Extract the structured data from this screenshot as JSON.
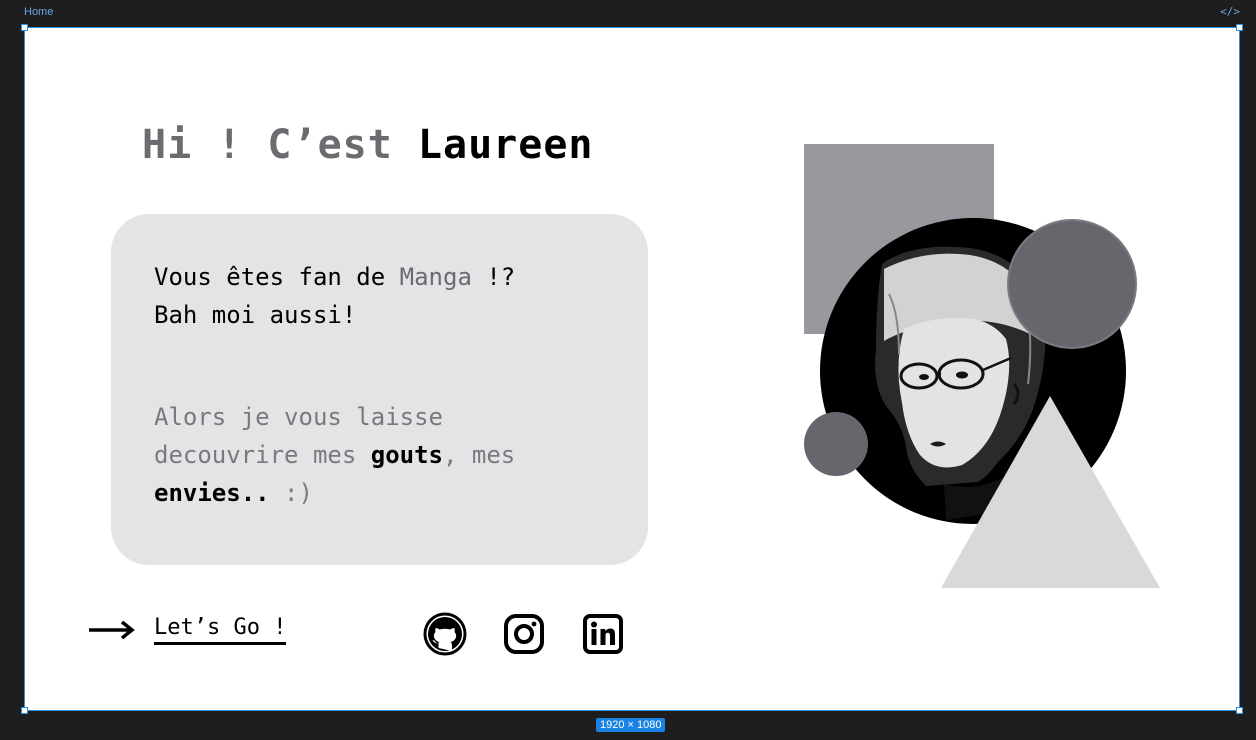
{
  "editor": {
    "frame_name": "Home",
    "code_toggle": "</>",
    "size_badge": "1920 × 1080"
  },
  "hero": {
    "greeting_light": "Hi ! C’est ",
    "greeting_name": "Laureen"
  },
  "card": {
    "line1_pre": "Vous êtes fan de ",
    "line1_accent": "Manga",
    "line1_post": " !?",
    "line2": "Bah moi aussi!",
    "line3": "Alors je vous laisse",
    "line4_pre": "decouvrire mes ",
    "line4_strong": "gouts",
    "line4_post": ", mes",
    "line5_strong": "envies..",
    "line5_post": " :)"
  },
  "cta": {
    "label": "Let’s Go !"
  },
  "social": [
    {
      "icon": "github-icon"
    },
    {
      "icon": "instagram-icon"
    },
    {
      "icon": "linkedin-icon"
    }
  ],
  "colors": {
    "frame_border": "#2f8fe0",
    "card_bg": "#e4e4e6",
    "accent_grey": "#6b6b70",
    "square": "#98989f",
    "circle_dark": "#66666c",
    "triangle": "#d9d9d9"
  }
}
